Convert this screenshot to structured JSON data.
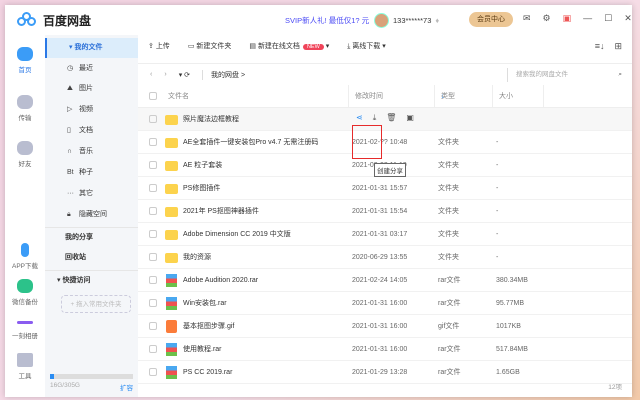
{
  "app": {
    "title": "百度网盘",
    "promo": "SVIP新人礼! 最低仅1? 元",
    "user": "133******73",
    "vip_btn": "会员中心"
  },
  "left_nav": [
    {
      "label": "首页"
    },
    {
      "label": "传输"
    },
    {
      "label": "好友"
    },
    {
      "label": "APP下载"
    },
    {
      "label": "微信备份"
    },
    {
      "label": "一刻相册"
    },
    {
      "label": "工具"
    }
  ],
  "sidebar": {
    "my_files": "我的文件",
    "items": [
      {
        "label": "最近",
        "icon": "clock"
      },
      {
        "label": "图片",
        "icon": "image"
      },
      {
        "label": "视频",
        "icon": "play"
      },
      {
        "label": "文档",
        "icon": "doc"
      },
      {
        "label": "音乐",
        "icon": "headphones"
      },
      {
        "label": "种子",
        "icon": "bt"
      },
      {
        "label": "其它",
        "icon": "more"
      },
      {
        "label": "隐藏空间",
        "icon": "lock"
      }
    ],
    "my_share": "我的分享",
    "recycle": "回收站",
    "quick": "快捷访问",
    "drag_hint": "+ 拖入常用文件夹",
    "quota": "16G/305G",
    "quota_used": 0.05,
    "expand": "扩容"
  },
  "toolbar": {
    "upload": "上传",
    "new_folder": "新建文件夹",
    "new_doc": "新建在线文档",
    "new_badge": "NEW",
    "offline": "离线下载"
  },
  "nav": {
    "path": "我的网盘",
    "search_placeholder": "搜索我的网盘文件"
  },
  "columns": {
    "name": "文件名",
    "modified": "修改时间",
    "type": "类型",
    "size": "大小"
  },
  "tooltip": "创建分享",
  "files": [
    {
      "name": "照片魔法边框教程",
      "date": "",
      "type": "",
      "size": "",
      "kind": "folder"
    },
    {
      "name": "AE全套插件一键安装包Pro v4.7 无需注册码",
      "date": "2021-02-?? 10:48",
      "type": "文件夹",
      "size": "-",
      "kind": "folder"
    },
    {
      "name": "AE 粒子套装",
      "date": "2021-02-02 11:19",
      "type": "文件夹",
      "size": "-",
      "kind": "folder"
    },
    {
      "name": "PS修图插件",
      "date": "2021-01-31 15:57",
      "type": "文件夹",
      "size": "-",
      "kind": "folder"
    },
    {
      "name": "2021年 PS抠图神器插件",
      "date": "2021-01-31 15:54",
      "type": "文件夹",
      "size": "-",
      "kind": "folder"
    },
    {
      "name": "Adobe Dimension CC 2019 中文版",
      "date": "2021-01-31 03:17",
      "type": "文件夹",
      "size": "-",
      "kind": "folder"
    },
    {
      "name": "我的资源",
      "date": "2020-06-29 13:55",
      "type": "文件夹",
      "size": "-",
      "kind": "folder"
    },
    {
      "name": "Adobe Audition 2020.rar",
      "date": "2021-02-24 14:05",
      "type": "rar文件",
      "size": "380.34MB",
      "kind": "rar"
    },
    {
      "name": "Win安装包.rar",
      "date": "2021-01-31 16:00",
      "type": "rar文件",
      "size": "95.77MB",
      "kind": "rar"
    },
    {
      "name": "基本抠图步骤.gif",
      "date": "2021-01-31 16:00",
      "type": "gif文件",
      "size": "1017KB",
      "kind": "gif"
    },
    {
      "name": "使用教程.rar",
      "date": "2021-01-31 16:00",
      "type": "rar文件",
      "size": "517.84MB",
      "kind": "rar"
    },
    {
      "name": "PS CC 2019.rar",
      "date": "2021-01-29 13:28",
      "type": "rar文件",
      "size": "1.65GB",
      "kind": "rar"
    }
  ],
  "footer": {
    "count": "12项"
  }
}
